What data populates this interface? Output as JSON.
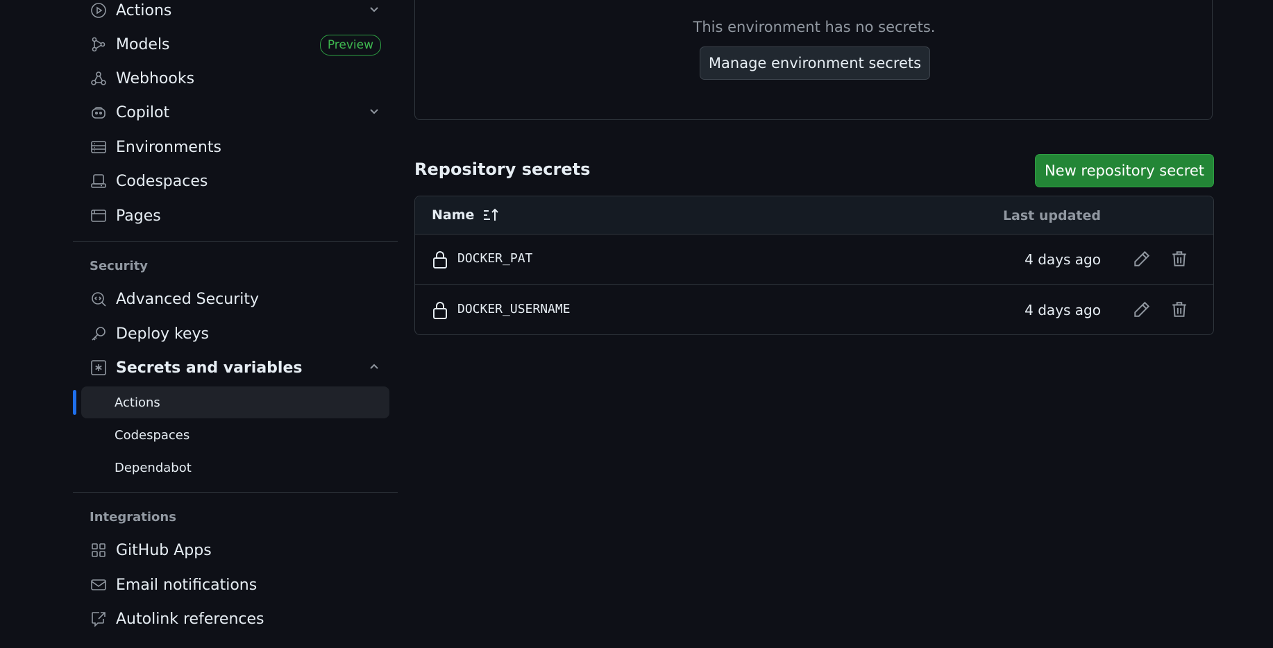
{
  "sidebar": {
    "items": [
      {
        "label": "Actions",
        "icon": "play-circle-icon"
      },
      {
        "label": "Models",
        "icon": "models-icon",
        "badge": "Preview"
      },
      {
        "label": "Webhooks",
        "icon": "webhook-icon"
      },
      {
        "label": "Copilot",
        "icon": "copilot-icon"
      },
      {
        "label": "Environments",
        "icon": "server-icon"
      },
      {
        "label": "Codespaces",
        "icon": "codespaces-icon"
      },
      {
        "label": "Pages",
        "icon": "browser-icon"
      }
    ],
    "security": {
      "title": "Security",
      "items": [
        {
          "label": "Advanced Security",
          "icon": "codescan-icon"
        },
        {
          "label": "Deploy keys",
          "icon": "key-icon"
        },
        {
          "label": "Secrets and variables",
          "icon": "asterisk-icon"
        }
      ],
      "subitems": [
        "Actions",
        "Codespaces",
        "Dependabot"
      ],
      "active_subitem": "Actions"
    },
    "integrations": {
      "title": "Integrations",
      "items": [
        {
          "label": "GitHub Apps",
          "icon": "apps-icon"
        },
        {
          "label": "Email notifications",
          "icon": "mail-icon"
        },
        {
          "label": "Autolink references",
          "icon": "autolink-icon"
        }
      ]
    }
  },
  "environment": {
    "message": "This environment has no secrets.",
    "manage_label": "Manage environment secrets"
  },
  "repository_secrets": {
    "title": "Repository secrets",
    "new_label": "New repository secret",
    "columns": {
      "name": "Name",
      "updated": "Last updated"
    },
    "rows": [
      {
        "name": "DOCKER_PAT",
        "updated": "4 days ago"
      },
      {
        "name": "DOCKER_USERNAME",
        "updated": "4 days ago"
      }
    ]
  },
  "colors": {
    "background": "#0e1017",
    "accent": "#1f6feb",
    "primary_button": "#238636",
    "badge": "#3fb950"
  }
}
